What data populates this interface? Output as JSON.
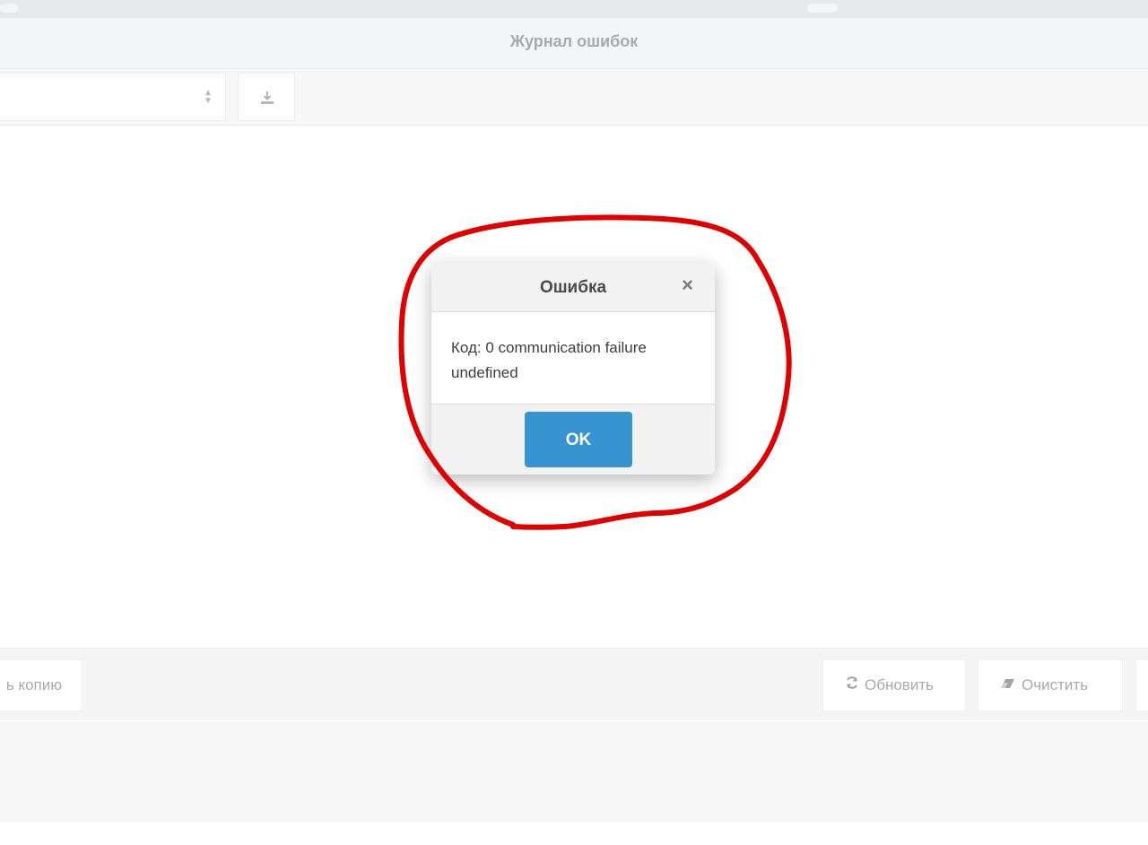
{
  "window": {
    "title": "Журнал ошибок"
  },
  "toolbar": {
    "select_value": "",
    "download_icon": "download-icon"
  },
  "bottom_toolbar": {
    "copy_label": "ь копию",
    "refresh_label": "Обновить",
    "refresh_icon": "refresh-icon",
    "clear_label": "Очистить",
    "clear_icon": "eraser-icon"
  },
  "dialog": {
    "title": "Ошибка",
    "close_symbol": "×",
    "message_line1": "Код: 0 communication failure",
    "message_line2": "undefined",
    "ok_label": "OK"
  },
  "colors": {
    "accent": "#3893d1",
    "annotation": "#e00000"
  }
}
